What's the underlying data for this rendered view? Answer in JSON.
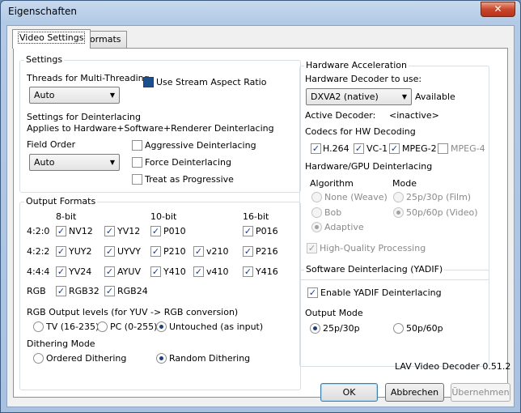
{
  "window": {
    "title": "Eigenschaften",
    "close_glyph": "✕"
  },
  "tabs": [
    "Video Settings",
    "Formats"
  ],
  "settings": {
    "title": "Settings",
    "threads_label": "Threads for Multi-Threading",
    "threads_value": "Auto",
    "stream_aspect_label": "Use Stream Aspect Ratio",
    "stream_aspect_checked": true,
    "deint_title": "Settings for Deinterlacing",
    "deint_subtitle": "Applies to Hardware+Software+Renderer Deinterlacing",
    "field_order_label": "Field Order",
    "field_order_value": "Auto",
    "aggressive_label": "Aggressive Deinterlacing",
    "force_label": "Force Deinterlacing",
    "progressive_label": "Treat as Progressive"
  },
  "output": {
    "title": "Output Formats",
    "col_8bit": "8-bit",
    "col_10bit": "10-bit",
    "col_16bit": "16-bit",
    "rows": {
      "r420": {
        "label": "4:2:0",
        "nv12": "NV12",
        "yv12": "YV12",
        "p010": "P010",
        "p016": "P016"
      },
      "r422": {
        "label": "4:2:2",
        "yuy2": "YUY2",
        "uyvy": "UYVY",
        "p210": "P210",
        "v210": "v210",
        "p216": "P216"
      },
      "r444": {
        "label": "4:4:4",
        "yv24": "YV24",
        "ayuv": "AYUV",
        "y410": "Y410",
        "v410": "v410",
        "y416": "Y416"
      },
      "rgb": {
        "label": "RGB",
        "rgb32": "RGB32",
        "rgb24": "RGB24"
      }
    },
    "rgb_levels_label": "RGB Output levels (for YUV -> RGB conversion)",
    "rgb_levels": [
      "TV (16-235)",
      "PC (0-255)",
      "Untouched (as input)"
    ],
    "dither_label": "Dithering Mode",
    "dither": [
      "Ordered Dithering",
      "Random Dithering"
    ]
  },
  "hw": {
    "title": "Hardware Acceleration",
    "decoder_label": "Hardware Decoder to use:",
    "decoder_value": "DXVA2 (native)",
    "available": "Available",
    "active_label": "Active Decoder:",
    "active_value": "<inactive>",
    "codecs_label": "Codecs for HW Decoding",
    "codecs": [
      "H.264",
      "VC-1",
      "MPEG-2",
      "MPEG-4"
    ],
    "gpu_deint_label": "Hardware/GPU Deinterlacing",
    "algorithm_label": "Algorithm",
    "algorithms": [
      "None (Weave)",
      "Bob",
      "Adaptive"
    ],
    "mode_label": "Mode",
    "modes": [
      "25p/30p (Film)",
      "50p/60p (Video)"
    ],
    "hq_label": "High-Quality Processing"
  },
  "yadif": {
    "title": "Software Deinterlacing (YADIF)",
    "enable_label": "Enable YADIF Deinterlacing",
    "output_mode_label": "Output Mode",
    "modes": [
      "25p/30p",
      "50p/60p"
    ]
  },
  "version": "LAV Video Decoder 0.51.2",
  "buttons": {
    "ok": "OK",
    "cancel": "Abbrechen",
    "apply": "Übernehmen"
  },
  "icons": {
    "combo_arrow": "▼",
    "check": "✓"
  }
}
